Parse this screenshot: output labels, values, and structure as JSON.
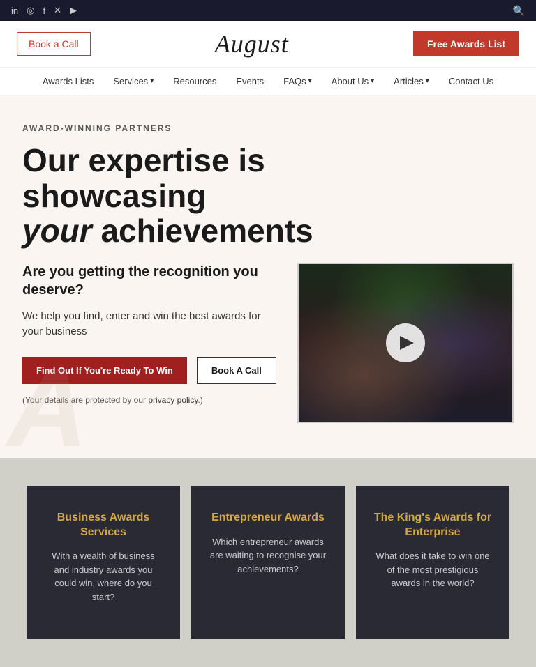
{
  "topbar": {
    "social_icons": [
      {
        "name": "linkedin-icon",
        "glyph": "in"
      },
      {
        "name": "instagram-icon",
        "glyph": "◎"
      },
      {
        "name": "facebook-icon",
        "glyph": "f"
      },
      {
        "name": "twitter-icon",
        "glyph": "✕"
      },
      {
        "name": "youtube-icon",
        "glyph": "▶"
      }
    ],
    "search_icon": "🔍"
  },
  "header": {
    "book_call_label": "Book a Call",
    "logo": "August",
    "free_awards_label": "Free Awards List"
  },
  "nav": {
    "items": [
      {
        "label": "Awards Lists",
        "has_dropdown": false
      },
      {
        "label": "Services",
        "has_dropdown": true
      },
      {
        "label": "Resources",
        "has_dropdown": false
      },
      {
        "label": "Events",
        "has_dropdown": false
      },
      {
        "label": "FAQs",
        "has_dropdown": true
      },
      {
        "label": "About Us",
        "has_dropdown": true
      },
      {
        "label": "Articles",
        "has_dropdown": true
      },
      {
        "label": "Contact Us",
        "has_dropdown": false
      }
    ]
  },
  "hero": {
    "tag": "AWARD-WINNING PARTNERS",
    "title_line1": "Our expertise is showcasing",
    "title_line2_italic": "your",
    "title_line2_rest": " achievements",
    "subtitle": "Are you getting the recognition you deserve?",
    "description": "We help you find, enter and win the best awards for your business",
    "btn_primary": "Find Out If You're Ready To Win",
    "btn_secondary": "Book A Call",
    "privacy_text_before": "(Your details are protected by our ",
    "privacy_link": "privacy policy",
    "privacy_text_after": ".)"
  },
  "cards": [
    {
      "title": "Business Awards Services",
      "description": "With a wealth of business and industry awards you could win, where do you start?"
    },
    {
      "title": "Entrepreneur Awards",
      "description": "Which entrepreneur awards are waiting to recognise your achievements?"
    },
    {
      "title": "The King's Awards for Enterprise",
      "description": "What does it take to win one of the most prestigious awards in the world?"
    }
  ]
}
